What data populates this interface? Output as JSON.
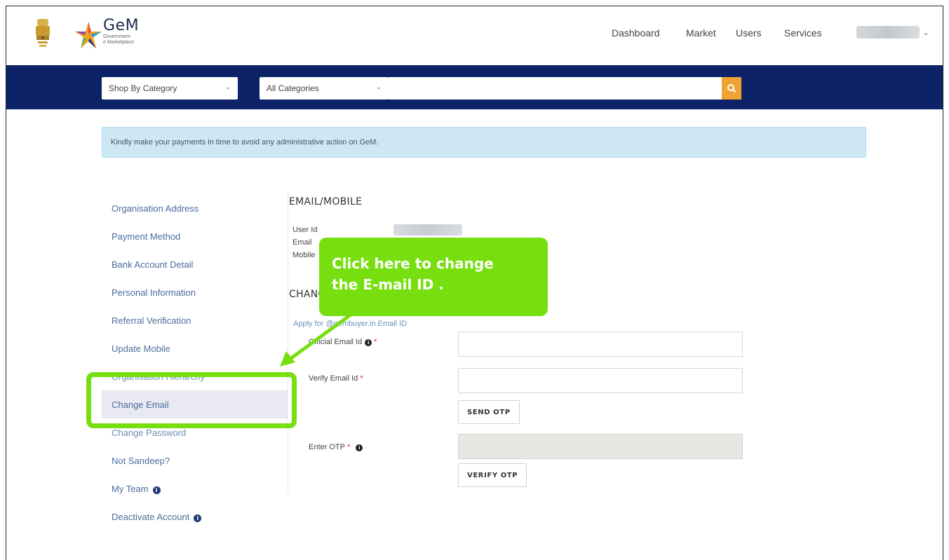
{
  "header": {
    "brand_name": "GeM",
    "brand_sub_1": "Government",
    "brand_sub_2": "e Marketplace",
    "nav": [
      "Dashboard",
      "Market",
      "Users",
      "Services"
    ],
    "user_name": "Sandeep"
  },
  "searchbar": {
    "shop_by_category": "Shop By Category",
    "all_categories": "All Categories",
    "search_placeholder": ""
  },
  "alert": {
    "message": "Kindly make your payments in time to avoid any administrative action on GeM."
  },
  "sidebar": {
    "items": [
      "Organisation Address",
      "Payment Method",
      "Bank Account Detail",
      "Personal Information",
      "Referral Verification",
      "Update Mobile",
      "Organisation Hierarchy",
      "Change Email",
      "Change Password",
      "Not Sandeep?",
      "My Team",
      "Deactivate Account"
    ],
    "active": "Change Email"
  },
  "main": {
    "section_title": "EMAIL/MOBILE",
    "fields": [
      "User Id",
      "Email",
      "Mobile"
    ],
    "change_title": "CHANGE EMAIL",
    "apply_link": "Apply for @gembuyer.in Email ID",
    "official_email_label": "Official Email Id",
    "verify_email_label": "Verify Email Id",
    "send_otp": "SEND OTP",
    "enter_otp_label": "Enter OTP",
    "verify_otp": "VERIFY OTP"
  },
  "callout": {
    "line1": "Click here to change",
    "line2": "the E-mail ID  ."
  },
  "colors": {
    "band": "#0c2368",
    "search_button": "#f0a233",
    "callout": "#77df0f",
    "alert_bg": "#cde7f3",
    "link": "#4a6d9c"
  }
}
